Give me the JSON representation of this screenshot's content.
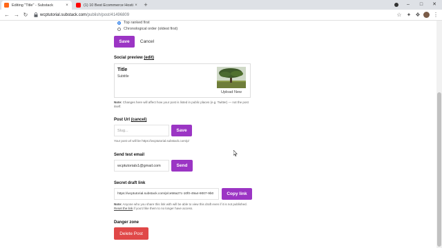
{
  "browser": {
    "tabs": [
      {
        "title": "Editing \"Title\" - Substack",
        "close": "×"
      },
      {
        "title": "(1) 10 Best Ecommerce Hosting ...",
        "close": "×"
      }
    ],
    "new_tab": "+",
    "window_controls": {
      "minimize": "–",
      "maximize": "□",
      "close": "✕"
    },
    "nav": {
      "back": "←",
      "forward": "→",
      "reload": "↻"
    },
    "url_host": "wcptutorial.substack.com",
    "url_path": "/publish/post/41496809"
  },
  "page": {
    "sort_options": [
      {
        "label": "Top ranked first",
        "checked": true
      },
      {
        "label": "Chronological order (oldest first)",
        "checked": false
      }
    ],
    "save_label": "Save",
    "cancel_label": "Cancel",
    "social_preview": {
      "heading": "Social preview",
      "edit_link": "(edit)",
      "card_title": "Title",
      "card_subtitle": "Subtitle",
      "upload_label": "Upload New",
      "note_bold": "Note:",
      "note_text": " Changes here will affect how your post is listed in public places (e.g. Twitter) — not the post itself."
    },
    "post_url": {
      "heading": "Post Url",
      "cancel_link": "(cancel)",
      "slug_placeholder": "Slug...",
      "save_label": "Save",
      "helper": "Your post url will be https://wcptutorial.substack.com/p/"
    },
    "test_email": {
      "heading": "Send test email",
      "email_value": "wcptutorials1@gmail.com",
      "send_label": "Send"
    },
    "draft_link": {
      "heading": "Secret draft link",
      "link_value": "https://wcptutorial.substack.com/p/ce58a27c-10f0-49a4-9007-9b0",
      "copy_label": "Copy link",
      "note_bold": "Note:",
      "note_text": " Anyone who you share this link with will be able to view this draft even if it is not published. ",
      "reset_link": "Reset the link",
      "note_tail": " if you'd like them to no longer have access."
    },
    "danger": {
      "heading": "Danger zone",
      "delete_label": "Delete Post"
    }
  },
  "colors": {
    "accent": "#9b35c4",
    "danger": "#e04848",
    "substack_brand": "#ff6719",
    "youtube_brand": "#ff0000"
  }
}
